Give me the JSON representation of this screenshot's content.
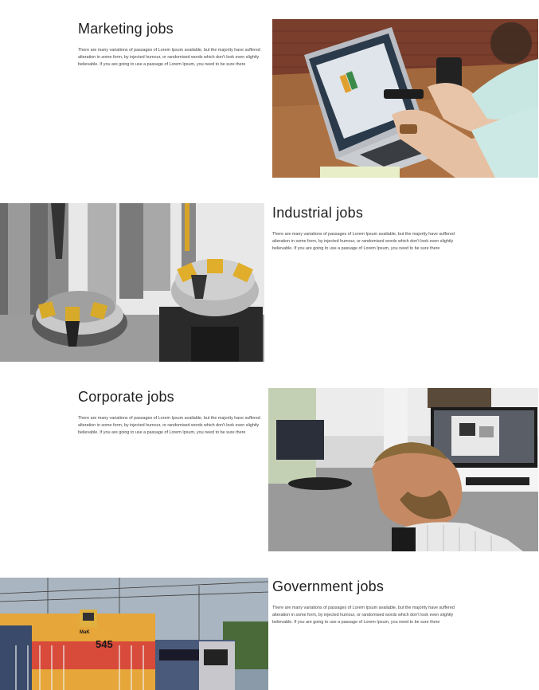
{
  "sections": [
    {
      "title": "Marketing jobs",
      "body": "There are many variations of passages of Lorem Ipsum available, but the majority have suffered alteration in some form, by injected humour, or randomised words which don't look even slightly believable. If you are going to use a passage of Lorem Ipsum, you need to be sure there",
      "image": "laptop-typing-photo"
    },
    {
      "title": "Industrial jobs",
      "body": "There are many variations of passages of Lorem Ipsum available, but the majority have suffered alteration in some form, by injected humour, or randomised words which don't look even slightly believable. If you are going to use a passage of Lorem Ipsum, you need to be sure there",
      "image": "milling-cutters-photo"
    },
    {
      "title": "Corporate jobs",
      "body": "There are many variations of passages of Lorem Ipsum available, but the majority have suffered alteration in some form, by injected humour, or randomised words which don't look even slightly believable. If you are going to use a passage of Lorem Ipsum, you need to be sure there",
      "image": "office-worker-photo"
    },
    {
      "title": "Government jobs",
      "body": "There are many variations of passages of Lorem Ipsum available, but the majority have suffered alteration in some form, by injected humour, or randomised words which don't look even slightly believable. If you are going to use a passage of Lorem Ipsum, you need to be sure there",
      "image": "locomotive-photo"
    }
  ],
  "locomotive_number": "545",
  "locomotive_brand": "MaK"
}
